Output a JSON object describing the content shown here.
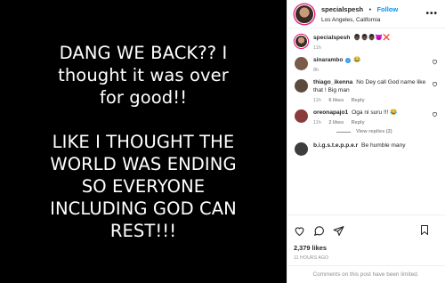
{
  "post": {
    "image_text": "DANG WE BACK?? I\nthought it was over\nfor good!!\n\nLIKE I THOUGHT THE\nWORLD WAS ENDING\nSO EVERYONE\nINCLUDING GOD CAN\nREST!!!"
  },
  "header": {
    "username": "specialspesh",
    "dot": "•",
    "follow_label": "Follow",
    "location": "Los Angeles, California",
    "more_label": "•••"
  },
  "caption": {
    "username": "specialspesh",
    "text": "👨🏿👨🏿👨🏿😈❌",
    "time": "11h"
  },
  "comments": [
    {
      "username": "sinarambo",
      "verified": true,
      "text": " 😂",
      "time": "8h",
      "likes": "",
      "reply": "",
      "color": "#7a5a48"
    },
    {
      "username": "thiago_ikenna",
      "verified": false,
      "text": "No Dey call God name like that ! Big man",
      "time": "11h",
      "likes": "6 likes",
      "reply": "Reply",
      "color": "#5c4a3e"
    },
    {
      "username": "oreonapajo1",
      "verified": false,
      "text": "Oga ni suru !!! 😂",
      "time": "11h",
      "likes": "2 likes",
      "reply": "Reply",
      "color": "#8a3b3b"
    },
    {
      "username": "b.i.g.s.t.e.p.p.e.r",
      "verified": false,
      "text": "Be humble many",
      "time": "",
      "likes": "",
      "reply": "",
      "color": "#3d3d3d"
    }
  ],
  "view_replies_label": "View replies (2)",
  "likes_label": "2,379 likes",
  "time_ago": "11 HOURS AGO",
  "limited_notice": "Comments on this post have been limited.",
  "colors": {
    "follow": "#0095f6",
    "muted": "#8e8e8e",
    "text": "#262626"
  }
}
